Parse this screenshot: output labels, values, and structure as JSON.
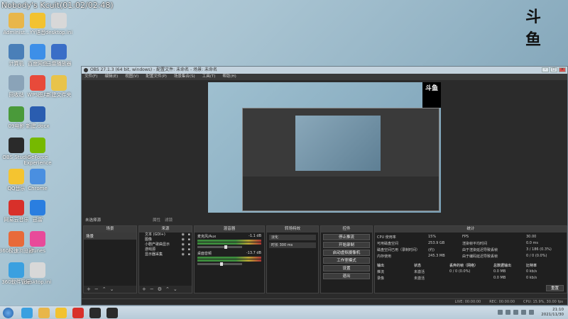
{
  "stream_title": "Nobody's Kcuit(01:02/02:48)",
  "douyu_logo": "斗鱼",
  "desktop_icons": [
    {
      "label": "Administ...",
      "color": "#e8b64a"
    },
    {
      "label": "YY语音",
      "color": "#f2c230"
    },
    {
      "label": "desktop.ini",
      "color": "#d8d8d8"
    },
    {
      "label": "计算机",
      "color": "#4a7fb8"
    },
    {
      "label": "百度网盘",
      "color": "#3d8fe8"
    },
    {
      "label": "迅雷播放器",
      "color": "#3a6ec7"
    },
    {
      "label": "回收站",
      "color": "#8aa3b8"
    },
    {
      "label": "WPS图片",
      "color": "#e84a3a"
    },
    {
      "label": "新建文件夹",
      "color": "#e8c34a"
    },
    {
      "label": "09电影",
      "color": "#4a9a3a"
    },
    {
      "label": "新建.docx",
      "color": "#2a5db0"
    },
    {
      "label": "OBS Studio",
      "color": "#2a2a2a"
    },
    {
      "label": "GeForce Experience",
      "color": "#76b900"
    },
    {
      "label": "QQ音乐",
      "color": "#f4c430"
    },
    {
      "label": "Chrome",
      "color": "#4a8fe0"
    },
    {
      "label": "网易云音乐",
      "color": "#d8302a"
    },
    {
      "label": "迅雷",
      "color": "#2a7ee0"
    },
    {
      "label": "360极速浏览器",
      "color": "#e86a3a"
    },
    {
      "label": "iTunes",
      "color": "#e84a9a"
    },
    {
      "label": "360软件管家",
      "color": "#3aa0e0"
    },
    {
      "label": "desktop.ini",
      "color": "#d8d8d8"
    }
  ],
  "obs": {
    "title": "OBS 27.1.3 (64 bit, windows) - 配置文件: 未命名 - 场景: 未命名",
    "menu": [
      "文件(F)",
      "编辑(E)",
      "视图(V)",
      "配置文件(P)",
      "场景集合(S)",
      "工具(T)",
      "帮助(H)"
    ],
    "scene_label": "未选择源",
    "scene_toolbar": [
      "属性",
      "滤镜"
    ],
    "docks": {
      "scenes": {
        "title": "场景",
        "items": [
          "场景"
        ]
      },
      "sources": {
        "title": "来源",
        "items": [
          "文本 (GDI+)",
          "图像",
          "小剧产歌曲显示",
          "游戏源",
          "显示器采集"
        ]
      },
      "mixer": {
        "title": "混音器",
        "channels": [
          {
            "name": "麦克风/Aux",
            "db": "-1.1 dB"
          },
          {
            "name": "桌面音频",
            "db": "-13.7 dB"
          }
        ]
      },
      "transitions": {
        "title": "转场特效",
        "type": "淡化",
        "duration_label": "时长",
        "duration_value": "300 ms"
      },
      "controls": {
        "title": "控件",
        "buttons": [
          "停止推流",
          "开始录制",
          "启动虚拟摄像机",
          "工作室模式",
          "设置",
          "退出"
        ]
      },
      "stats": {
        "title": "统计",
        "rows": [
          [
            "CPU 使用率",
            "15%",
            "FPS",
            "30.00"
          ],
          [
            "可用磁盘空间",
            "253.9 GB",
            "渲染帧平均时间",
            "0.0 ms"
          ],
          [
            "磁盘空间已用（录制时间）",
            "(约)",
            "由于渲染延迟导致丢帧",
            "3 / 186 (0.3%)"
          ],
          [
            "内存使用",
            "245.3 MB",
            "由于编码延迟导致丢帧",
            "0 / 0 (0.0%)"
          ]
        ],
        "table_headers": [
          "输出",
          "状态",
          "丢弃的帧（网络）",
          "总数据输出",
          "比特率"
        ],
        "table_rows": [
          [
            "推流",
            "未激活",
            "0 / 0 (0.0%)",
            "0.0 MB",
            "0 kb/s"
          ],
          [
            "录像",
            "未激活",
            "",
            "0.0 MB",
            "0 kb/s"
          ]
        ],
        "reset": "重置"
      }
    },
    "statusbar": [
      "LIVE: 00:00:00",
      "REC: 00:00:00",
      "CPU: 15.9%, 30.00 fps"
    ]
  },
  "taskbar": {
    "time": "21:10",
    "date": "2021/11/30",
    "apps": [
      "#3aa0e0",
      "#e8b64a",
      "#f2c230",
      "#d8302a",
      "#2a2a2a",
      "#2a2a2a"
    ]
  }
}
